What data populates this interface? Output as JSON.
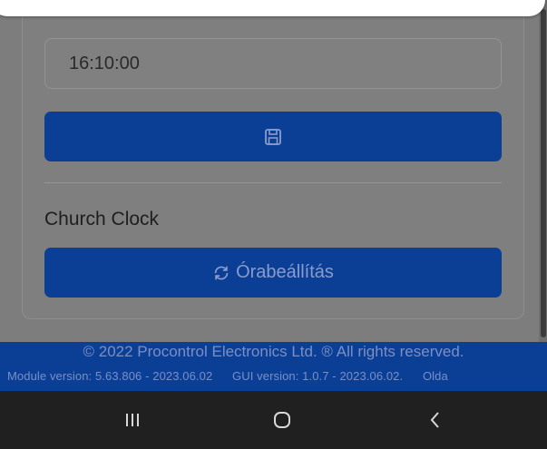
{
  "time_field": {
    "value": "16:10:00"
  },
  "save_button": {
    "icon": "floppy-disk-icon"
  },
  "church_clock": {
    "label": "Church Clock",
    "sync_button_label": "Órabeállítás",
    "sync_icon": "sync-icon"
  },
  "footer": {
    "copyright": "© 2022 Procontrol Electronics Ltd. ® All rights reserved.",
    "module_version": "Module version: 5.63.806 - 2023.06.02",
    "gui_version": "GUI version: 1.0.7 - 2023.06.02.",
    "truncated_text": "Olda"
  },
  "nav_bar": {
    "recents_icon": "recents-icon",
    "home_icon": "home-icon",
    "back_icon": "back-icon"
  },
  "colors": {
    "primary": "#0b3f96",
    "overlay_bg": "#7d7d7d",
    "nav_bg": "#202020"
  }
}
